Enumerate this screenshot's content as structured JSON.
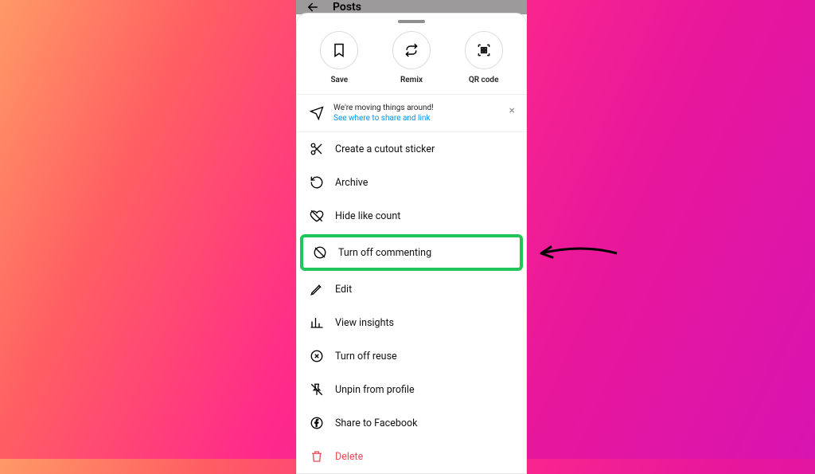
{
  "header": {
    "back_icon": "back",
    "title": "Posts"
  },
  "quick": [
    {
      "label": "Save",
      "icon": "save"
    },
    {
      "label": "Remix",
      "icon": "remix"
    },
    {
      "label": "QR code",
      "icon": "qr"
    }
  ],
  "notice": {
    "line1": "We're moving things around!",
    "line2": "See where to share and link",
    "close": "×"
  },
  "menu": [
    {
      "icon": "scissors",
      "label": "Create a cutout sticker"
    },
    {
      "icon": "archive",
      "label": "Archive"
    },
    {
      "icon": "hide",
      "label": "Hide like count"
    },
    {
      "icon": "hide",
      "label": "Turn off commenting",
      "highlight": true
    },
    {
      "icon": "edit",
      "label": "Edit"
    },
    {
      "icon": "insights",
      "label": "View insights"
    },
    {
      "icon": "circle-x",
      "label": "Turn off reuse"
    },
    {
      "icon": "unpin",
      "label": "Unpin from profile"
    },
    {
      "icon": "facebook",
      "label": "Share to Facebook"
    },
    {
      "icon": "trash",
      "label": "Delete",
      "danger": true
    }
  ],
  "annotation": {
    "arrow_color": "#000000"
  }
}
